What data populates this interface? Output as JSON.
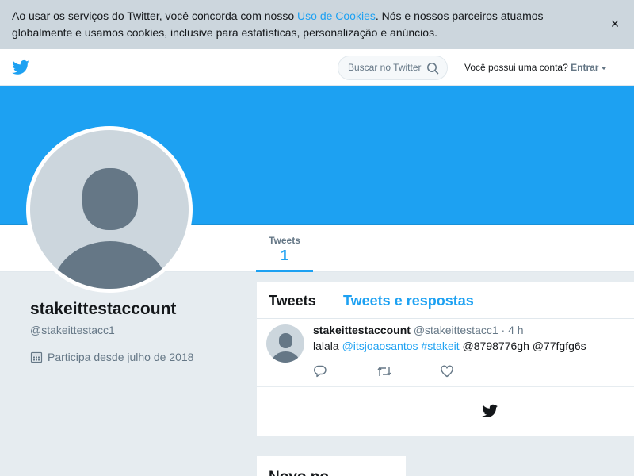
{
  "cookie": {
    "text_before": "Ao usar os serviços do Twitter, você concorda com nosso ",
    "link": "Uso de Cookies",
    "text_after": ". Nós e nossos parceiros atuamos globalmente e usamos cookies, inclusive para estatísticas, personalização e anúncios.",
    "close": "×"
  },
  "nav": {
    "search_placeholder": "Buscar no Twitter",
    "login_question": "Você possui uma conta?",
    "login_label": "Entrar"
  },
  "profile_nav": {
    "tweets_label": "Tweets",
    "tweets_count": "1"
  },
  "profile": {
    "name": "stakeittestaccount",
    "handle": "@stakeittestacc1",
    "joined": "Participa desde julho de 2018"
  },
  "timeline": {
    "tab_tweets": "Tweets",
    "tab_replies": "Tweets e respostas",
    "tweet": {
      "name": "stakeittestaccount",
      "handle": "@stakeittestacc1",
      "time": "· 4 h",
      "text_start": "lalala ",
      "mention": "@itsjoaosantos",
      "hashtag": "#stakeit",
      "text_end": " @8798776gh @77fgfg6s"
    }
  },
  "card2": {
    "title": "Novo no"
  },
  "colors": {
    "accent": "#1da1f2",
    "banner": "#1da1f2",
    "background": "#e6ecf0"
  },
  "icons": [
    "twitter-bird-icon",
    "search-icon",
    "close-icon",
    "calendar-icon",
    "reply-icon",
    "retweet-icon",
    "like-icon",
    "default-avatar-icon"
  ]
}
